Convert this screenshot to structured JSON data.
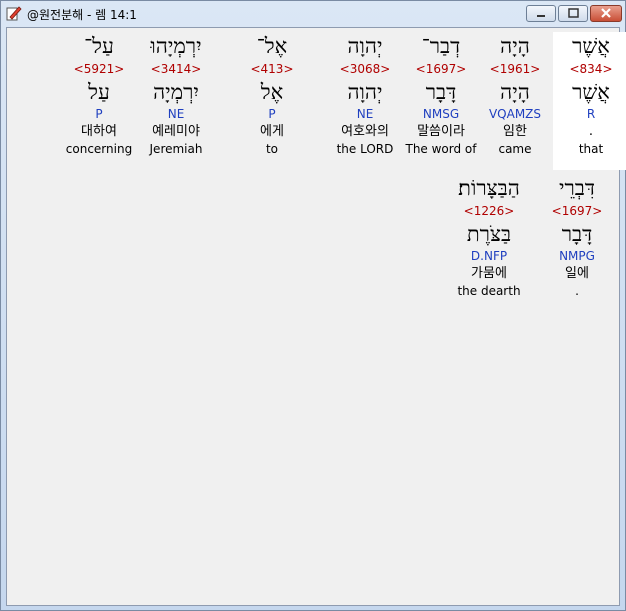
{
  "window": {
    "title": "@원전분해 - 렘 14:1",
    "buttons": {
      "minimize": "minimize",
      "maximize": "maximize",
      "close": "close"
    }
  },
  "line1": [
    {
      "hebrew": "אֲשֶׁר",
      "strong": "<834>",
      "lemma": "אֲשֶׁר",
      "parse": "R",
      "korean": ".",
      "english": "that",
      "selected": true
    },
    {
      "hebrew": "הָיָה",
      "strong": "<1961>",
      "lemma": "הָיָה",
      "parse": "VQAMZS",
      "korean": "임한",
      "english": "came"
    },
    {
      "hebrew": "דְבַר־",
      "strong": "<1697>",
      "lemma": "דָּבָר",
      "parse": "NMSG",
      "korean": "말씀이라",
      "english": "The word of"
    },
    {
      "hebrew": "יְהוָה",
      "strong": "<3068>",
      "lemma": "יְהוָה",
      "parse": "NE",
      "korean": "여호와의",
      "english": "the LORD"
    },
    {
      "hebrew": "אֶל־",
      "strong": "<413>",
      "lemma": "אֶל",
      "parse": "P",
      "korean": "에게",
      "english": "to"
    },
    {
      "hebrew": "יִרְמְיָהוּ",
      "strong": "<3414>",
      "lemma": "יִרְמְיָה",
      "parse": "NE",
      "korean": "예레미야",
      "english": "Jeremiah"
    },
    {
      "hebrew": "עַל־",
      "strong": "<5921>",
      "lemma": "עַל",
      "parse": "P",
      "korean": "대하여",
      "english": "concerning"
    }
  ],
  "line2": [
    {
      "hebrew": "דִּבְרֵי",
      "strong": "<1697>",
      "lemma": "דָּבָר",
      "parse": "NMPG",
      "korean": "일에",
      "english": "."
    },
    {
      "hebrew": "הַבַּצָּרוֹת׃",
      "strong": "<1226>",
      "lemma": "בַּצֹּרֶת",
      "parse": "D.NFP",
      "korean": "가뭄에",
      "english": "the dearth"
    }
  ]
}
